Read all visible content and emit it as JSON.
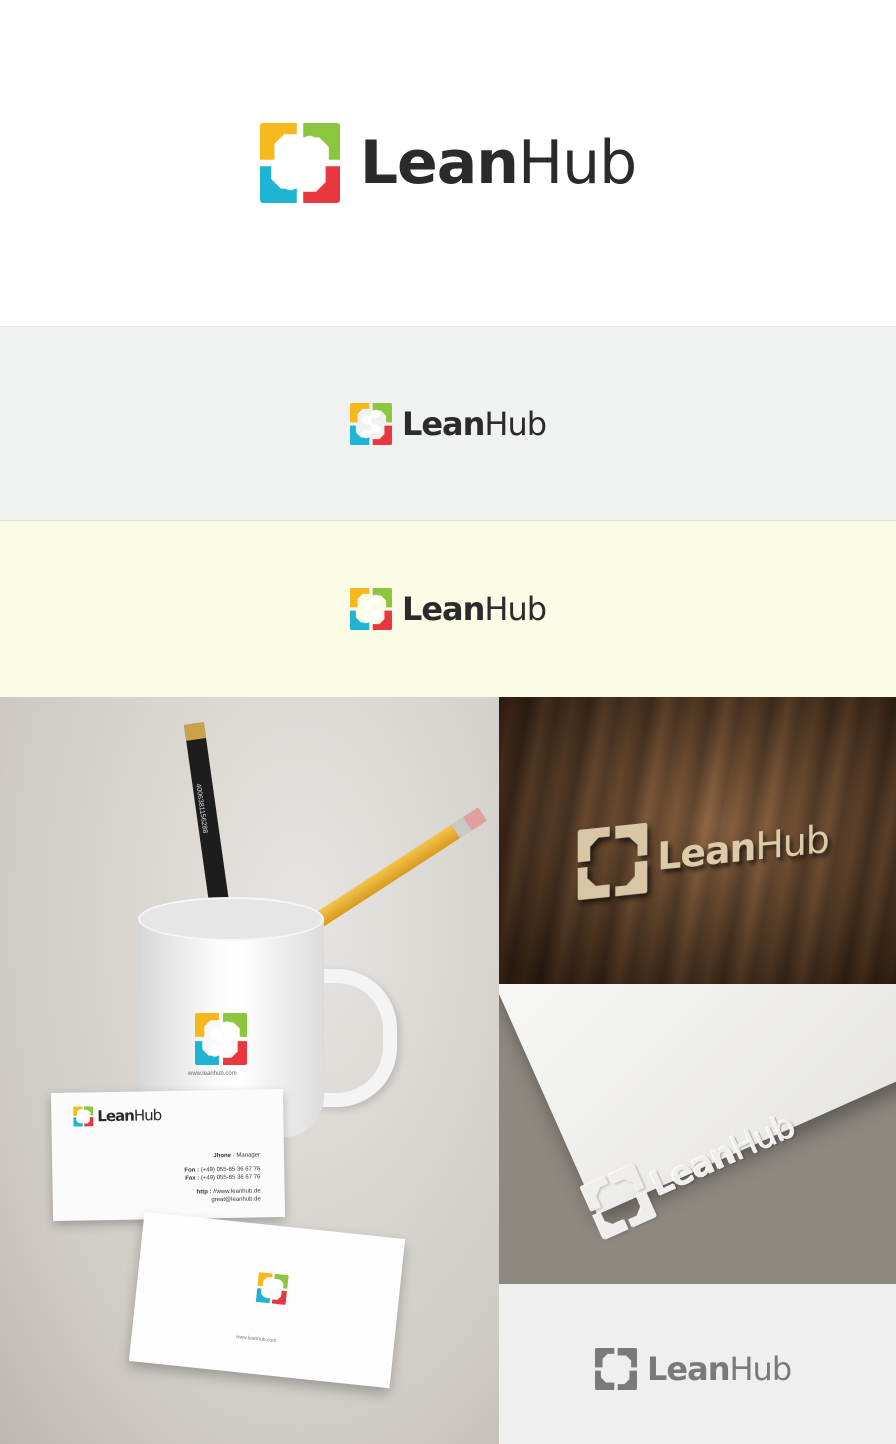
{
  "brand": {
    "name_bold": "Lean",
    "name_light": "Hub",
    "colors": {
      "yellow": "#f6b81c",
      "green": "#8cc63f",
      "blue": "#1fb4d2",
      "red": "#e8373f",
      "text": "#2b2b2b"
    },
    "icon": "four-arrow-hub-logo-icon"
  },
  "bands": {
    "white_bg": "#ffffff",
    "gray_bg": "#f0f1f1",
    "cream_bg": "#fcfce6"
  },
  "mockups": {
    "card": {
      "name": "Jhone",
      "role": "Manager",
      "fon_label": "Fon :",
      "fon": "(+49) 055-65 36 67 76",
      "fax_label": "Fax :",
      "fax": "(+49) 055-65 36 67 76",
      "http_label": "http :",
      "url": "//www.leanhub.de",
      "email": "great@leanhub.de"
    },
    "mug_url": "www.leanhub.com",
    "card_back_url": "www.leanhub.com",
    "pencil_code": "4006381156288"
  }
}
